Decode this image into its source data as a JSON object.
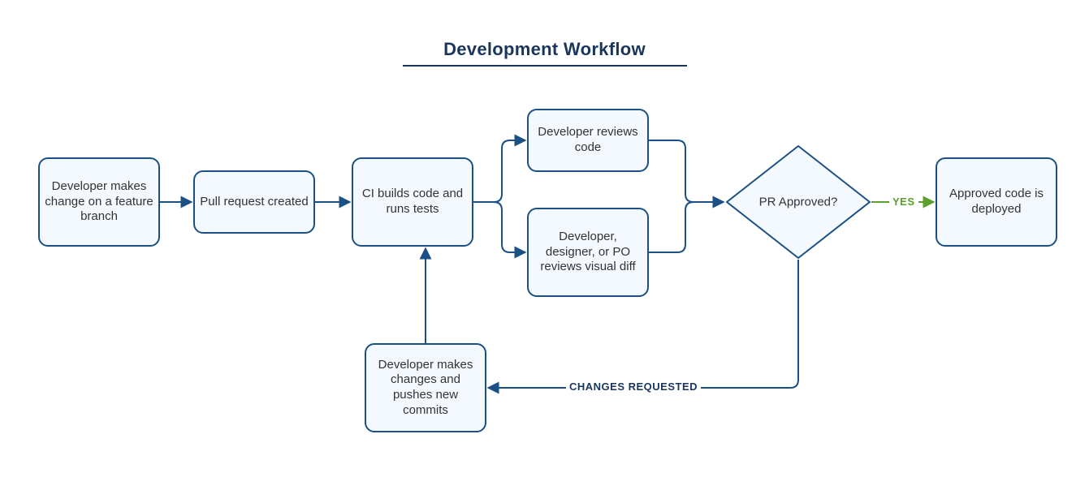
{
  "title": "Development Workflow",
  "nodes": {
    "n1": "Developer makes change on a feature branch",
    "n2": "Pull request created",
    "n3": "CI builds code and runs tests",
    "n4": "Developer reviews code",
    "n5": "Developer, designer, or PO reviews visual diff",
    "n6": "PR Approved?",
    "n7": "Approved code is deployed",
    "n8": "Developer makes changes and pushes new commits"
  },
  "edges": {
    "yes": "YES",
    "changes": "CHANGES REQUESTED"
  },
  "colors": {
    "stroke": "#1b5084",
    "fill": "#f3f9ff",
    "yes": "#5aa02c"
  }
}
